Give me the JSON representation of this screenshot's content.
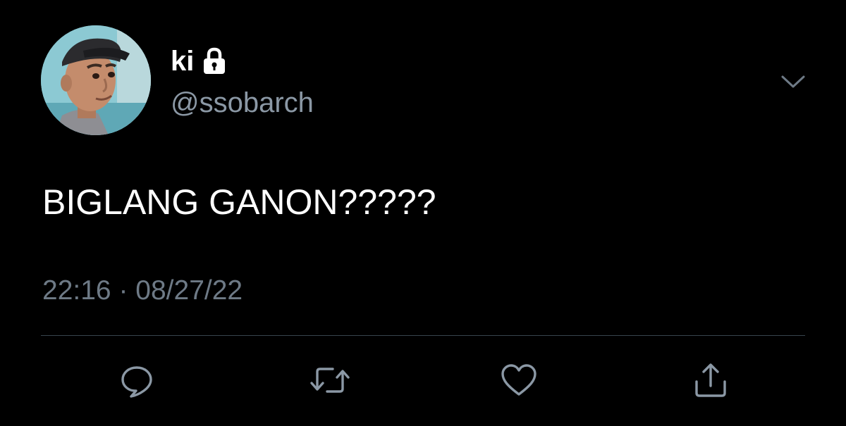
{
  "author": {
    "display_name": "ki",
    "protected_icon": "lock-icon",
    "handle": "@ssobarch",
    "avatar": "cartoon-character-avatar"
  },
  "tweet": {
    "text": "BIGLANG GANON?????",
    "time": "22:16",
    "separator": "·",
    "date": "08/27/22",
    "meta_line": "22:16 · 08/27/22"
  },
  "menu": {
    "icon": "chevron-down-icon"
  },
  "actions": [
    {
      "name": "reply",
      "icon": "reply-icon"
    },
    {
      "name": "retweet",
      "icon": "retweet-icon"
    },
    {
      "name": "like",
      "icon": "heart-icon"
    },
    {
      "name": "share",
      "icon": "share-icon"
    }
  ],
  "colors": {
    "background": "#000000",
    "primary_text": "#ffffff",
    "secondary_text": "#8b98a5",
    "icon": "#8b98a5",
    "divider": "#38444d"
  }
}
